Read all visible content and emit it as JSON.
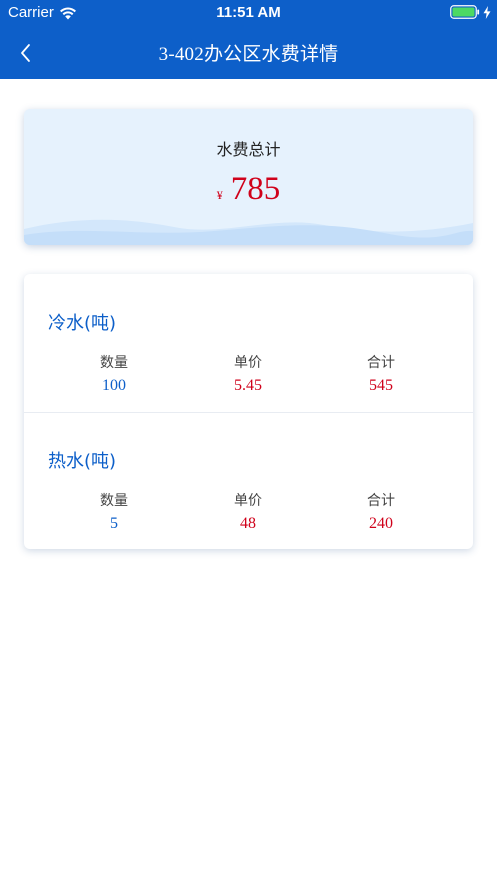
{
  "status_bar": {
    "carrier": "Carrier",
    "time": "11:51 AM",
    "battery_level": 1.0
  },
  "nav": {
    "title": "3-402办公区水费详情"
  },
  "summary": {
    "title": "水费总计",
    "currency": "¥",
    "amount": "785"
  },
  "sections": [
    {
      "title": "冷水(吨)",
      "columns": [
        {
          "label": "数量",
          "value": "100"
        },
        {
          "label": "单价",
          "value": "5.45"
        },
        {
          "label": "合计",
          "value": "545"
        }
      ]
    },
    {
      "title": "热水(吨)",
      "columns": [
        {
          "label": "数量",
          "value": "5"
        },
        {
          "label": "单价",
          "value": "48"
        },
        {
          "label": "合计",
          "value": "240"
        }
      ]
    }
  ],
  "colors": {
    "primary": "#0d5fc9",
    "price_red": "#d0021b",
    "card_bg": "#e6f2fd"
  },
  "icons": {
    "back": "chevron-left-icon",
    "wifi": "wifi-icon",
    "battery": "battery-icon",
    "charging": "bolt-icon"
  }
}
